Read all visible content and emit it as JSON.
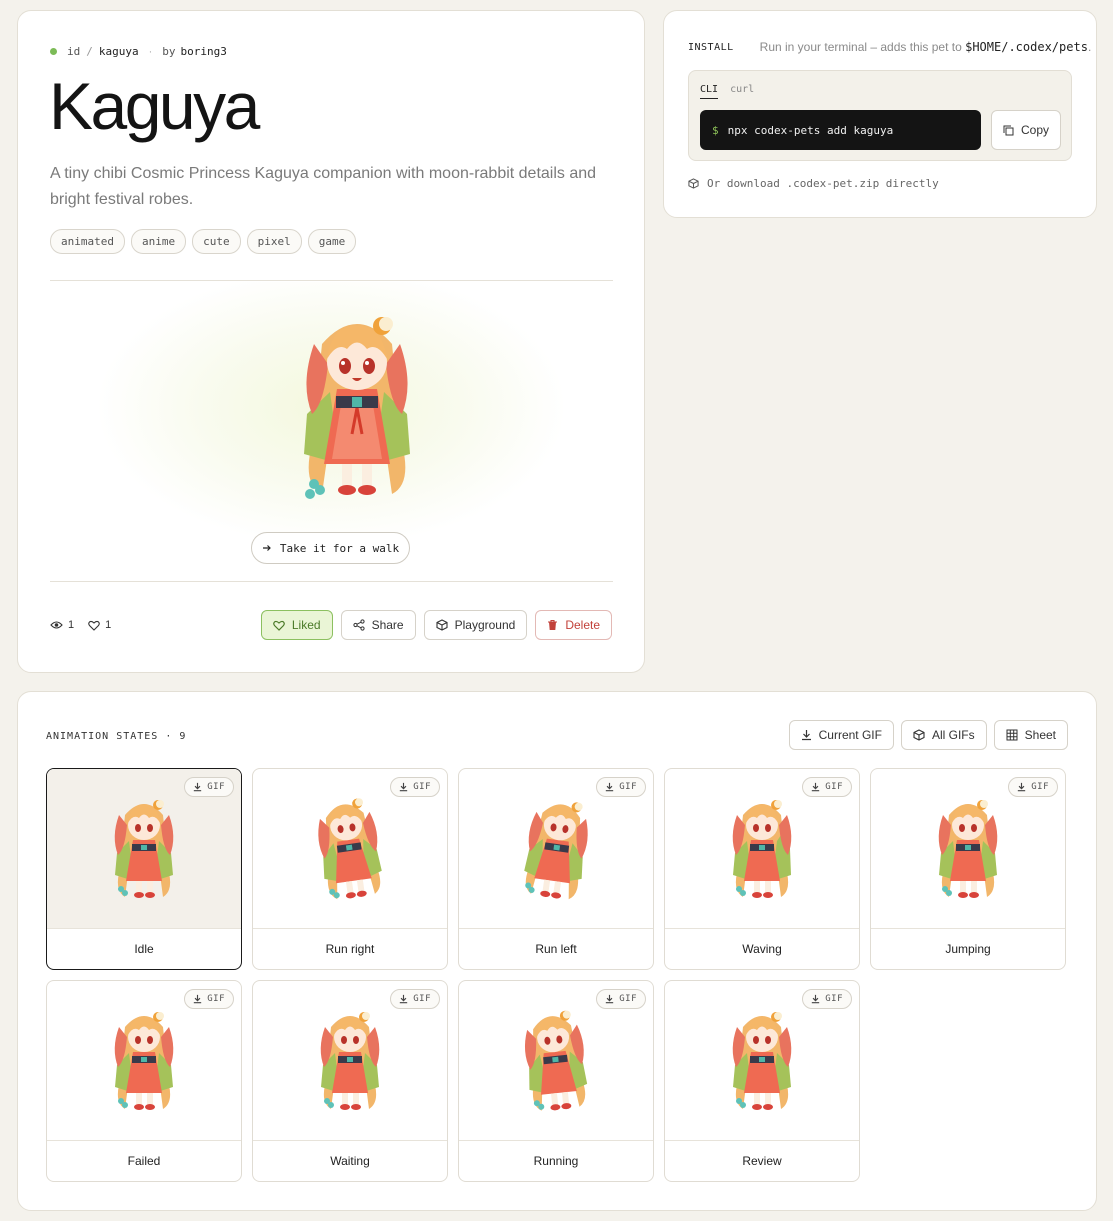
{
  "hero": {
    "id_label": "id",
    "id_sep": "/",
    "id_value": "kaguya",
    "by_label": "by",
    "author": "boring3",
    "title": "Kaguya",
    "description": "A tiny chibi Cosmic Princess Kaguya companion with moon-rabbit details and bright festival robes.",
    "tags": [
      "animated",
      "anime",
      "cute",
      "pixel",
      "game"
    ],
    "walk_button": "Take it for a walk",
    "views": "1",
    "likes": "1",
    "actions": {
      "liked": "Liked",
      "share": "Share",
      "playground": "Playground",
      "delete": "Delete"
    }
  },
  "install": {
    "label": "INSTALL",
    "note_prefix": "Run in your terminal – adds this pet to ",
    "note_path": "$HOME/.codex/pets",
    "note_suffix": ".",
    "tabs": [
      "CLI",
      "curl"
    ],
    "active_tab": "CLI",
    "prompt": "$",
    "command": "npx codex-pets add kaguya",
    "copy": "Copy",
    "download_text": "Or download .codex-pet.zip directly"
  },
  "animation": {
    "heading": "ANIMATION STATES · 9",
    "buttons": {
      "current_gif": "Current GIF",
      "all_gifs": "All GIFs",
      "sheet": "Sheet"
    },
    "gif_label": "GIF",
    "states": [
      {
        "label": "Idle"
      },
      {
        "label": "Run right"
      },
      {
        "label": "Run left"
      },
      {
        "label": "Waving"
      },
      {
        "label": "Jumping"
      },
      {
        "label": "Failed"
      },
      {
        "label": "Waiting"
      },
      {
        "label": "Running"
      },
      {
        "label": "Review"
      }
    ],
    "selected": "Idle"
  },
  "colors": {
    "background": "#f4f2ec",
    "liked_bg": "#eaf5d6",
    "liked_border": "#8cc060",
    "delete": "#c2413a",
    "terminal": "#141414",
    "prompt": "#8fc45a"
  },
  "icons": [
    "eye-icon",
    "heart-icon",
    "share-icon",
    "cube-icon",
    "trash-icon",
    "copy-icon",
    "download-icon",
    "grid-icon",
    "arrow-right-icon"
  ]
}
